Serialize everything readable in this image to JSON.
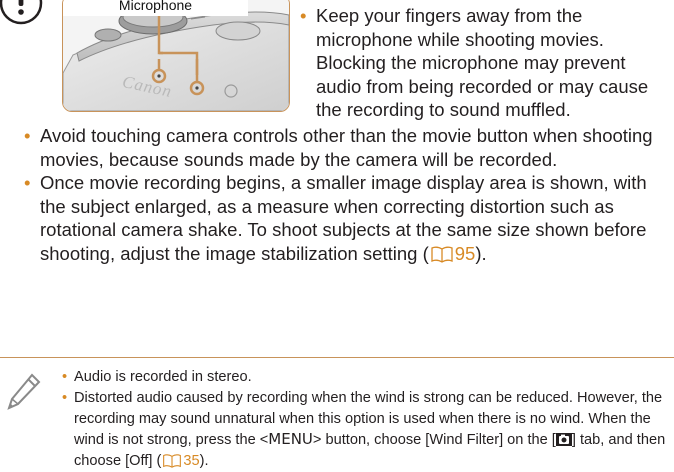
{
  "photo": {
    "label": "Microphone",
    "brand": "Canon"
  },
  "caution": {
    "icon": "caution-icon",
    "side_bullet": "Keep your fingers away from the microphone while shooting movies. Blocking the microphone may prevent audio from being recorded or may cause the recording to sound muffled.",
    "bullet2": "Avoid touching camera controls other than the movie button when shooting movies, because sounds made by the camera will be recorded.",
    "bullet3_text": "Once movie recording begins, a smaller image display area is shown, with the subject enlarged, as a measure when correcting distortion such as rotational camera shake. To shoot subjects at the same size shown before shooting, adjust the image stabilization setting (",
    "bullet3_ref": "95",
    "bullet3_close": ")."
  },
  "notes": {
    "icon": "pencil-icon",
    "bullet1": "Audio is recorded in stereo.",
    "bullet2_part1": "Distorted audio caused by recording when the wind is strong can be reduced. However, the recording may sound unnatural when this option is used when there is no wind. When the wind is not strong, press the <",
    "menu_key": "MENU",
    "bullet2_part2": "> button, choose [Wind Filter] on the [",
    "bullet2_part3": "] tab, and then choose [Off] (",
    "bullet2_ref": "35",
    "bullet2_close": ")."
  },
  "colors": {
    "accent": "#d88a25",
    "frame": "#c8935a",
    "text": "#231f20"
  }
}
